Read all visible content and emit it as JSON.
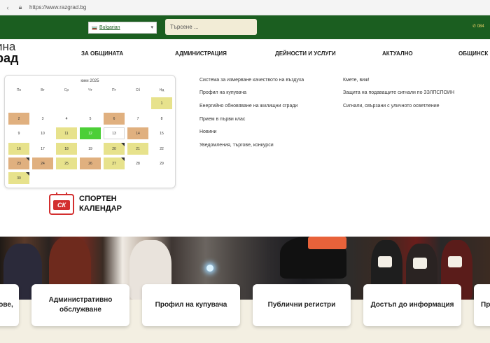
{
  "browser": {
    "url": "https://www.razgrad.bg"
  },
  "header": {
    "language": "Bulgarian",
    "search_placeholder": "Търсене ...",
    "phone": "084"
  },
  "logo": {
    "line1": "ина",
    "line2": "рад"
  },
  "nav": [
    {
      "label": "ЗА ОБЩИНАТА"
    },
    {
      "label": "АДМИНИСТРАЦИЯ"
    },
    {
      "label": "ДЕЙНОСТИ И УСЛУГИ"
    },
    {
      "label": "АКТУАЛНО"
    },
    {
      "label": "ОБЩИНСК"
    }
  ],
  "calendar": {
    "month": "юни 2025",
    "weekdays": [
      "Пн",
      "Вт",
      "Ср",
      "Чт",
      "Пт",
      "Сб",
      "Нд"
    ],
    "days": [
      {
        "n": "1",
        "cls": "y",
        "tri": false
      },
      {
        "n": "2",
        "cls": "o",
        "tri": false
      },
      {
        "n": "3",
        "cls": "",
        "tri": false
      },
      {
        "n": "4",
        "cls": "",
        "tri": false
      },
      {
        "n": "5",
        "cls": "",
        "tri": false
      },
      {
        "n": "6",
        "cls": "o",
        "tri": false
      },
      {
        "n": "7",
        "cls": "",
        "tri": false
      },
      {
        "n": "8",
        "cls": "",
        "tri": false
      },
      {
        "n": "9",
        "cls": "",
        "tri": false
      },
      {
        "n": "10",
        "cls": "",
        "tri": false
      },
      {
        "n": "11",
        "cls": "y",
        "tri": false
      },
      {
        "n": "12",
        "cls": "g",
        "tri": false
      },
      {
        "n": "13",
        "cls": "t",
        "tri": false
      },
      {
        "n": "14",
        "cls": "o",
        "tri": false
      },
      {
        "n": "15",
        "cls": "",
        "tri": false
      },
      {
        "n": "16",
        "cls": "y",
        "tri": false
      },
      {
        "n": "17",
        "cls": "",
        "tri": false
      },
      {
        "n": "18",
        "cls": "y",
        "tri": false
      },
      {
        "n": "19",
        "cls": "",
        "tri": false
      },
      {
        "n": "20",
        "cls": "y",
        "tri": true
      },
      {
        "n": "21",
        "cls": "y",
        "tri": false
      },
      {
        "n": "22",
        "cls": "",
        "tri": false
      },
      {
        "n": "23",
        "cls": "o",
        "tri": true
      },
      {
        "n": "24",
        "cls": "o",
        "tri": false
      },
      {
        "n": "25",
        "cls": "y",
        "tri": false
      },
      {
        "n": "26",
        "cls": "o",
        "tri": false
      },
      {
        "n": "27",
        "cls": "y",
        "tri": true
      },
      {
        "n": "28",
        "cls": "",
        "tri": false
      },
      {
        "n": "29",
        "cls": "",
        "tri": false
      },
      {
        "n": "30",
        "cls": "y",
        "tri": true
      }
    ]
  },
  "sport_calendar": {
    "line1": "СПОРТЕН",
    "line2": "КАЛЕНДАР",
    "badge": "СК"
  },
  "quick_links": {
    "col1": [
      "Система за измерване качеството на въздуха",
      "Профил на купувача",
      "Енергийно обновяване на жилищни сгради",
      "Прием в първи клас",
      "Новини",
      "Уведомления, търгове, конкурси"
    ],
    "col2": [
      "Кмете, виж!",
      "Защита на подаващите сигнали по ЗЗЛПСПОИН",
      "Сигнали, свързани с уличното осветление"
    ]
  },
  "cards": [
    {
      "label": "ове,"
    },
    {
      "label": "Административно обслужване"
    },
    {
      "label": "Профил на купувача"
    },
    {
      "label": "Публични регистри"
    },
    {
      "label": "Достъп до информация"
    },
    {
      "label": "Пр"
    }
  ],
  "colors": {
    "header_green": "#1b5e20",
    "calendar_yellow": "#e7e28c",
    "calendar_orange": "#e0b07f",
    "calendar_today_green": "#4ccf37",
    "sport_red": "#d32f2f"
  }
}
